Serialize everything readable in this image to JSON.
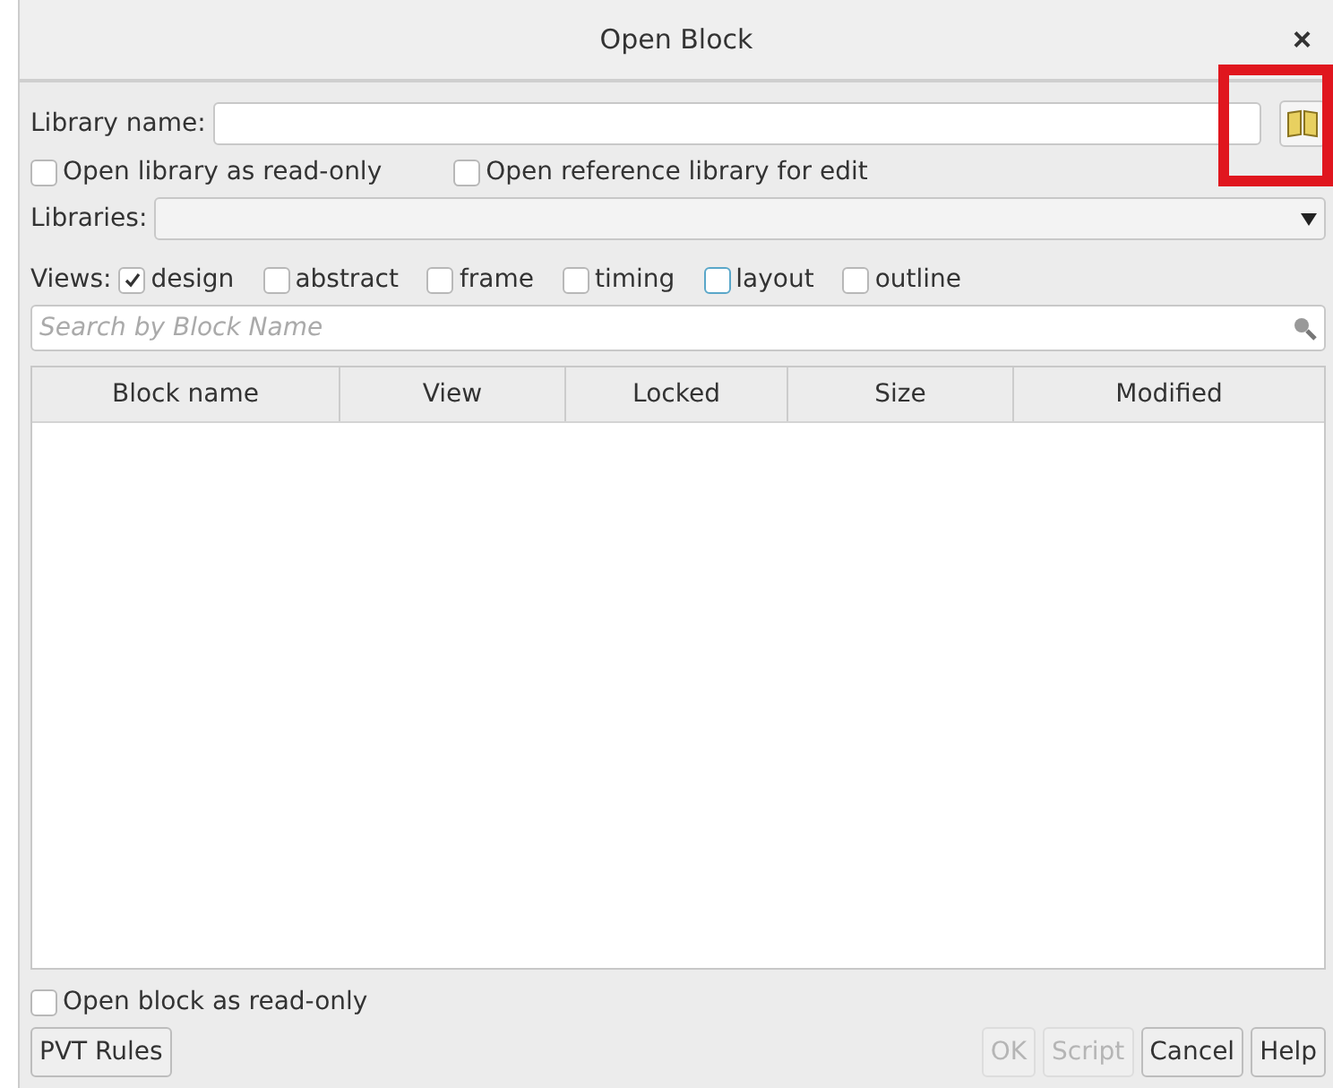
{
  "window": {
    "title": "Open Block",
    "close": "×"
  },
  "library_name": {
    "label": "Library name:"
  },
  "options": [
    {
      "label": "Open library as read-only",
      "checked": false
    },
    {
      "label": "Open reference library for edit",
      "checked": false
    }
  ],
  "libraries": {
    "label": "Libraries:"
  },
  "views": {
    "label": "Views:",
    "items": [
      {
        "label": "design",
        "checked": true,
        "focused": false
      },
      {
        "label": "abstract",
        "checked": false,
        "focused": false
      },
      {
        "label": "frame",
        "checked": false,
        "focused": false
      },
      {
        "label": "timing",
        "checked": false,
        "focused": false
      },
      {
        "label": "layout",
        "checked": false,
        "focused": true
      },
      {
        "label": "outline",
        "checked": false,
        "focused": false
      }
    ]
  },
  "search": {
    "placeholder": "Search by Block Name"
  },
  "table": {
    "columns": [
      "Block name",
      "View",
      "Locked",
      "Size",
      "Modified"
    ]
  },
  "read_only": {
    "label": "Open block as read-only",
    "checked": false
  },
  "buttons": [
    {
      "label": "PVT Rules",
      "disabled": false
    },
    {
      "label": "OK",
      "disabled": true
    },
    {
      "label": "Script",
      "disabled": true
    },
    {
      "label": "Cancel",
      "disabled": false
    },
    {
      "label": "Help",
      "disabled": false
    }
  ]
}
